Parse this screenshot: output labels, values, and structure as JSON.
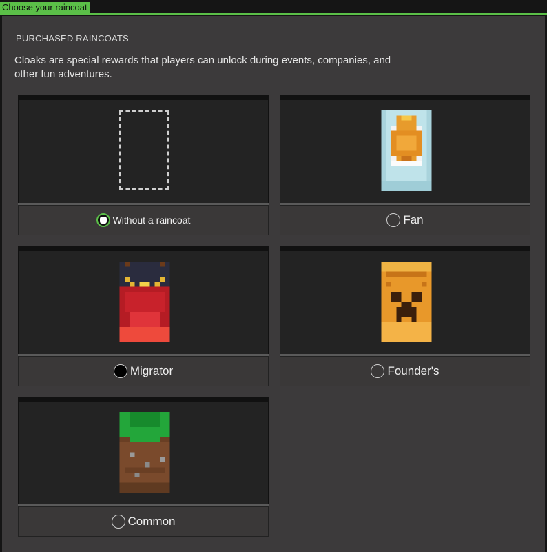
{
  "window": {
    "title": "Choose your raincoat"
  },
  "section": {
    "title": "PURCHASED RAINCOATS",
    "description": "Cloaks are special rewards that players can unlock during events, companies, and other fun adventures."
  },
  "cloaks": [
    {
      "label": "Without a raincoat",
      "selected": true,
      "icon": "empty-slot-icon"
    },
    {
      "label": "Fan",
      "selected": false,
      "icon": "fan-cloak-icon"
    },
    {
      "label": "Migrator",
      "selected": false,
      "icon": "migrator-cloak-icon"
    },
    {
      "label": "Founder's",
      "selected": false,
      "icon": "founders-cloak-icon"
    },
    {
      "label": "Common",
      "selected": false,
      "icon": "common-cloak-icon"
    }
  ],
  "colors": {
    "accent": "#5bbf48",
    "panel": "#3c3a3b",
    "card": "#232323"
  }
}
